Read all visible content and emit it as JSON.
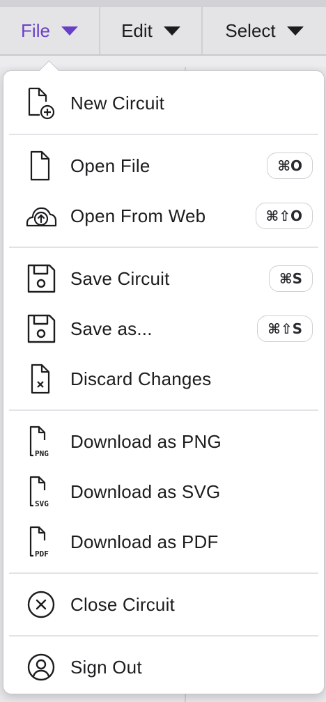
{
  "menubar": {
    "tabs": [
      {
        "label": "File"
      },
      {
        "label": "Edit"
      },
      {
        "label": "Select"
      }
    ]
  },
  "menu": {
    "items": [
      {
        "label": "New Circuit",
        "icon": "new-file-icon",
        "shortcut": ""
      },
      {
        "label": "Open File",
        "icon": "file-icon",
        "shortcut": "⌘O"
      },
      {
        "label": "Open From Web",
        "icon": "cloud-upload-icon",
        "shortcut": "⌘⇧O"
      },
      {
        "label": "Save Circuit",
        "icon": "save-icon",
        "shortcut": "⌘S"
      },
      {
        "label": "Save as...",
        "icon": "save-as-icon",
        "shortcut": "⌘⇧S"
      },
      {
        "label": "Discard Changes",
        "icon": "discard-file-icon",
        "shortcut": ""
      },
      {
        "label": "Download as PNG",
        "icon": "png-file-icon",
        "badge": "PNG",
        "shortcut": ""
      },
      {
        "label": "Download as SVG",
        "icon": "svg-file-icon",
        "badge": "SVG",
        "shortcut": ""
      },
      {
        "label": "Download as PDF",
        "icon": "pdf-file-icon",
        "badge": "PDF",
        "shortcut": ""
      },
      {
        "label": "Close Circuit",
        "icon": "close-circle-icon",
        "shortcut": ""
      },
      {
        "label": "Sign Out",
        "icon": "user-circle-icon",
        "shortcut": ""
      }
    ]
  },
  "colors": {
    "accent": "#6a3fc8",
    "text": "#1c1c1e",
    "separator": "#e3e3e7"
  }
}
